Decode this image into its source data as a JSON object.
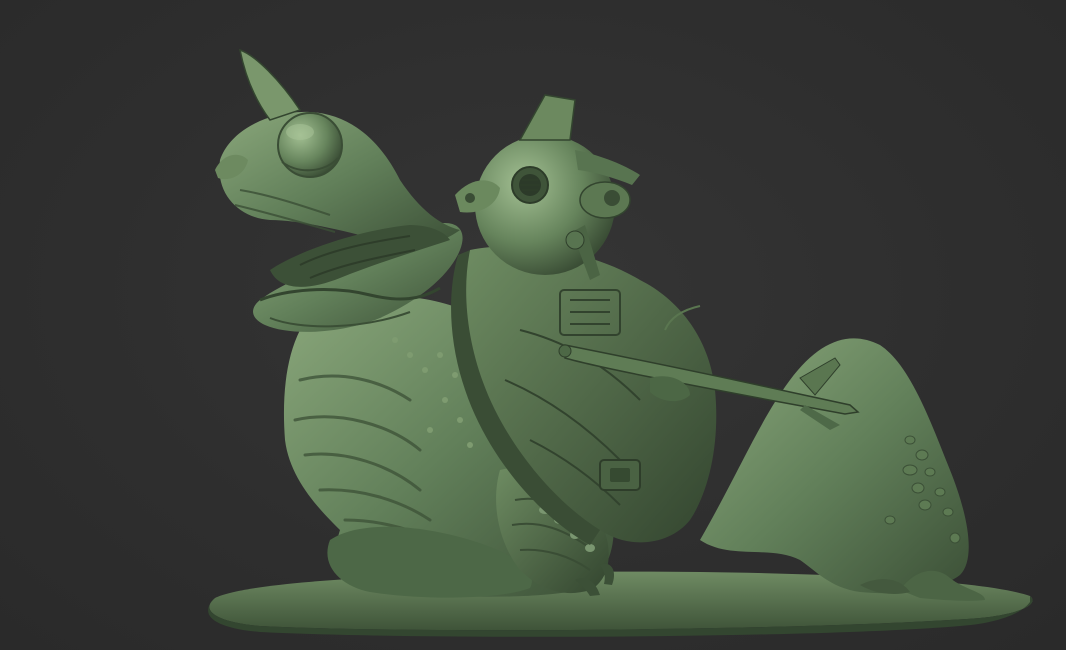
{
  "viewport": {
    "background_color": "#2f2f2f"
  },
  "sculpt": {
    "material_color": "#5c7a52",
    "highlight_color": "#8fae80",
    "shadow_color": "#2f3f2b"
  }
}
